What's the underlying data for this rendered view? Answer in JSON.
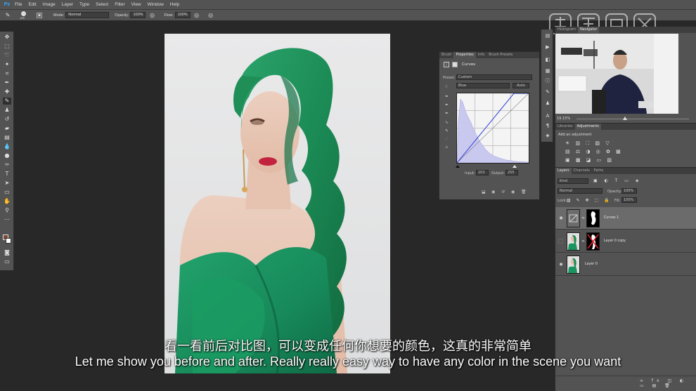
{
  "app": {
    "logo": "Ps"
  },
  "menu": [
    "File",
    "Edit",
    "Image",
    "Layer",
    "Type",
    "Select",
    "Filter",
    "View",
    "Window",
    "Help"
  ],
  "options": {
    "brush_size": "125",
    "mode_label": "Mode:",
    "mode_value": "Normal",
    "opacity_label": "Opacity:",
    "opacity_value": "100%",
    "flow_label": "Flow:",
    "flow_value": "100%"
  },
  "properties": {
    "tabs": [
      "Brush",
      "Properties",
      "Info",
      "Brush Presets"
    ],
    "active_tab": 1,
    "title": "Curves",
    "preset_label": "Preset:",
    "preset_value": "Custom",
    "channel_value": "Blue",
    "auto_label": "Auto",
    "input_label": "Input:",
    "input_value": "203",
    "output_label": "Output:",
    "output_value": "255"
  },
  "navigator": {
    "tabs": [
      "Histogram",
      "Navigator"
    ],
    "zoom": "19.15%"
  },
  "adjustments": {
    "tabs": [
      "Libraries",
      "Adjustments"
    ],
    "add_label": "Add an adjustment"
  },
  "layers": {
    "tabs": [
      "Layers",
      "Channels",
      "Paths"
    ],
    "filter_value": "Kind",
    "blend_mode": "Normal",
    "opacity_label": "Opacity:",
    "opacity_value": "100%",
    "lock_label": "Lock:",
    "fill_label": "Fill:",
    "fill_value": "100%",
    "items": [
      {
        "name": "Curves 1",
        "selected": true
      },
      {
        "name": "Layer 0 copy",
        "selected": false
      },
      {
        "name": "Layer 0",
        "selected": false
      }
    ]
  },
  "subtitles": {
    "cn": "看一看前后对比图，可以变成任何你想要的颜色，这真的非常简单",
    "en": "Let me show you before and after. Really really easy way to have any color in the scene you want"
  },
  "colors": {
    "hair": "#1e8a55",
    "dress": "#1c9460",
    "curve_fill": "#c9c8ef",
    "curve_line": "#2d3fd0"
  }
}
